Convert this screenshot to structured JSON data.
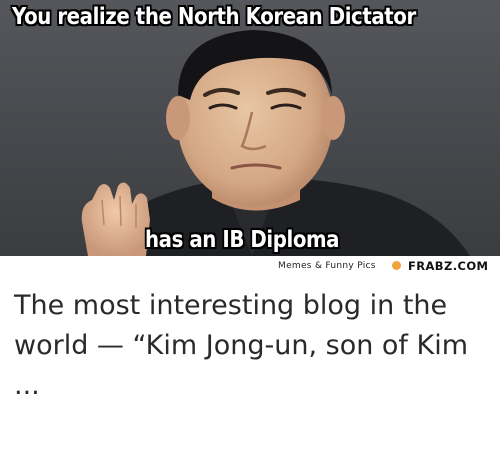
{
  "meme": {
    "top_caption": "You realize the North Korean Dictator",
    "bottom_caption": "has an IB Diploma",
    "watermark_left": "Memes & Funny Pics",
    "watermark_right": "FRABZ.COM"
  },
  "description_text": "The most interesting blog in the world — “Kim Jong-un, son of Kim ...",
  "colors": {
    "caption_text": "#ffffff",
    "caption_outline": "#000000",
    "background_photo": "#45474c",
    "watermark_accent": "#f0a43b",
    "body_text": "#2a2a2a"
  }
}
